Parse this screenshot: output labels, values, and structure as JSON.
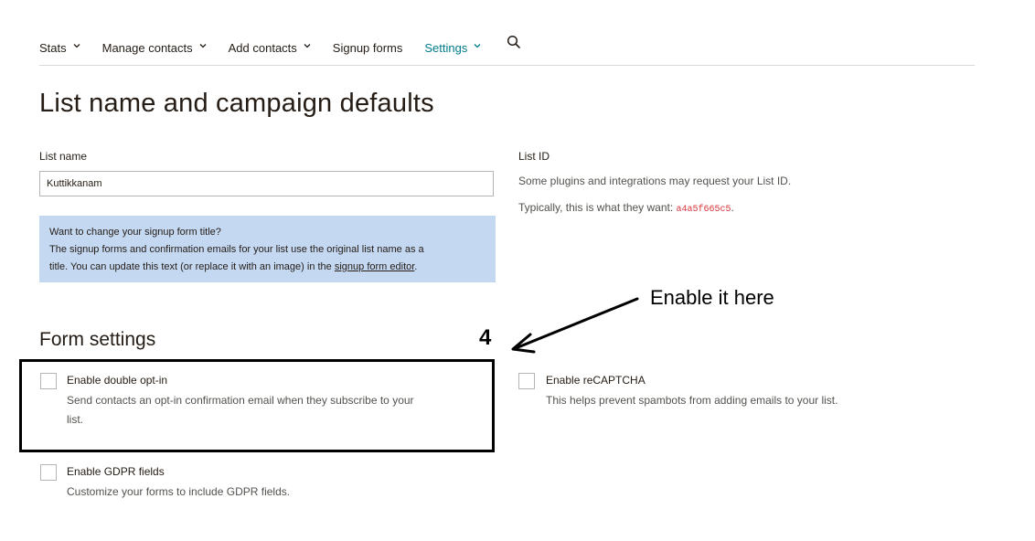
{
  "nav": {
    "items": [
      {
        "label": "Stats",
        "has_dropdown": true,
        "active": false
      },
      {
        "label": "Manage contacts",
        "has_dropdown": true,
        "active": false
      },
      {
        "label": "Add contacts",
        "has_dropdown": true,
        "active": false
      },
      {
        "label": "Signup forms",
        "has_dropdown": false,
        "active": false
      },
      {
        "label": "Settings",
        "has_dropdown": true,
        "active": true
      }
    ],
    "search_icon": "search-icon",
    "active_color": "#007c89"
  },
  "page_title": "List name and campaign defaults",
  "list_name": {
    "label": "List name",
    "value": "Kuttikkanam"
  },
  "info_box": {
    "title": "Want to change your signup form title?",
    "line1": "The signup forms and confirmation emails for your list use the original list name as a",
    "line2_prefix": "title. You can update this text (or replace it with an image) in the ",
    "link_text": "signup form editor",
    "line2_suffix": ".",
    "bg_color": "#c4d8f2"
  },
  "list_id": {
    "label": "List ID",
    "desc": "Some plugins and integrations may request your List ID.",
    "typical_prefix": "Typically, this is what they want: ",
    "id_value": "a4a5f665c5",
    "typical_suffix": "."
  },
  "form_settings": {
    "title": "Form settings",
    "options": [
      {
        "label": "Enable double opt-in",
        "desc_line1": "Send contacts an opt-in confirmation email when they subscribe to your",
        "desc_line2": "list.",
        "checked": false
      },
      {
        "label": "Enable reCAPTCHA",
        "desc_line1": "This helps prevent spambots from adding emails to your list.",
        "checked": false
      },
      {
        "label": "Enable GDPR fields",
        "desc_line1": "Customize your forms to include GDPR fields.",
        "checked": false
      }
    ]
  },
  "annotation": {
    "step_number": "4",
    "text": "Enable it here"
  }
}
